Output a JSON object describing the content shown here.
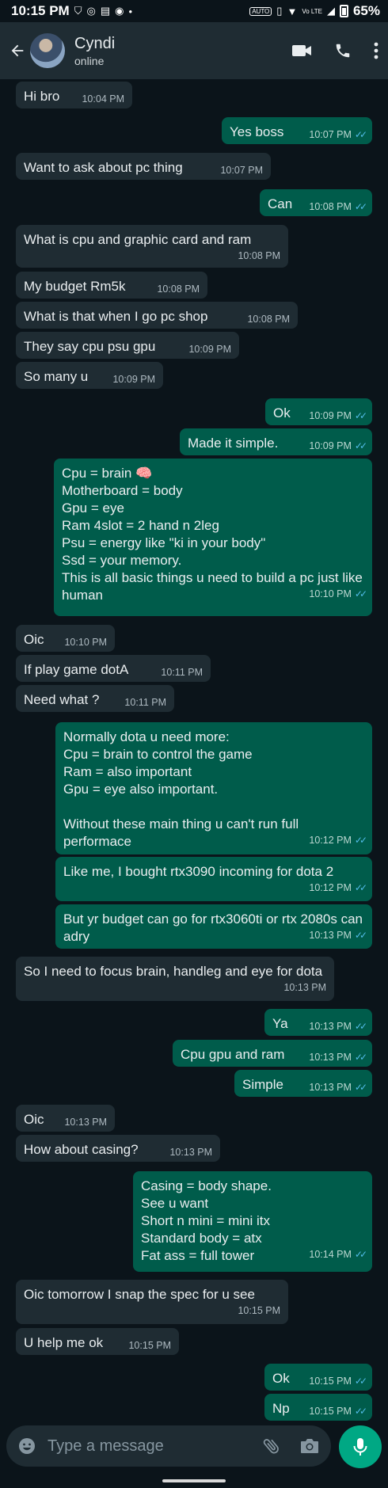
{
  "status_bar": {
    "time": "10:15 PM",
    "battery": "65%",
    "auto_label": "AUTO",
    "volte_label": "Vo LTE"
  },
  "header": {
    "contact_name": "Cyndi",
    "contact_status": "online"
  },
  "colors": {
    "incoming": "#1f2c33",
    "outgoing": "#005c4b",
    "accent": "#00a884",
    "read_ticks": "#53bdeb"
  },
  "messages": [
    {
      "dir": "in",
      "text": "Hi bro",
      "time": "10:04 PM"
    },
    {
      "dir": "out",
      "text": "Yes boss",
      "time": "10:07 PM"
    },
    {
      "dir": "in",
      "text": "Want to ask about pc thing",
      "time": "10:07 PM"
    },
    {
      "dir": "out",
      "text": "Can",
      "time": "10:08 PM"
    },
    {
      "dir": "in",
      "text": "What is cpu and graphic card and ram",
      "time": "10:08 PM"
    },
    {
      "dir": "in",
      "text": "My budget Rm5k",
      "time": "10:08 PM"
    },
    {
      "dir": "in",
      "text": "What is that when I go pc shop",
      "time": "10:08 PM"
    },
    {
      "dir": "in",
      "text": "They say cpu psu gpu",
      "time": "10:09 PM"
    },
    {
      "dir": "in",
      "text": "So many u",
      "time": "10:09 PM"
    },
    {
      "dir": "out",
      "text": "Ok",
      "time": "10:09 PM"
    },
    {
      "dir": "out",
      "text": "Made it simple.",
      "time": "10:09 PM"
    },
    {
      "dir": "out",
      "text": "Cpu = brain 🧠\nMotherboard = body\nGpu = eye\nRam 4slot = 2 hand n 2leg\nPsu = energy like \"ki in your body\"\nSsd = your memory.\nThis is all basic things u need to build a pc just like human",
      "time": "10:10 PM"
    },
    {
      "dir": "in",
      "text": "Oic",
      "time": "10:10 PM"
    },
    {
      "dir": "in",
      "text": "If play game dotA",
      "time": "10:11 PM"
    },
    {
      "dir": "in",
      "text": "Need what ?",
      "time": "10:11 PM"
    },
    {
      "dir": "out",
      "text": "Normally dota u need more:\nCpu = brain to control the game\nRam = also important\nGpu = eye also important.\n\nWithout these main thing u can't run full performace",
      "time": "10:12 PM"
    },
    {
      "dir": "out",
      "text": "Like me, I bought rtx3090 incoming for dota 2",
      "time": "10:12 PM"
    },
    {
      "dir": "out",
      "text": "But yr budget can go for rtx3060ti or rtx 2080s can adry",
      "time": "10:13 PM"
    },
    {
      "dir": "in",
      "text": "So I need to focus brain, handleg and eye for dota",
      "time": "10:13 PM"
    },
    {
      "dir": "out",
      "text": "Ya",
      "time": "10:13 PM"
    },
    {
      "dir": "out",
      "text": "Cpu gpu and ram",
      "time": "10:13 PM"
    },
    {
      "dir": "out",
      "text": "Simple",
      "time": "10:13 PM"
    },
    {
      "dir": "in",
      "text": "Oic",
      "time": "10:13 PM"
    },
    {
      "dir": "in",
      "text": "How about casing?",
      "time": "10:13 PM"
    },
    {
      "dir": "out",
      "text": "Casing = body shape.\nSee u want\nShort n mini = mini itx\nStandard body = atx\nFat ass = full tower",
      "time": "10:14 PM"
    },
    {
      "dir": "in",
      "text": "Oic tomorrow I snap the spec for u see",
      "time": "10:15 PM"
    },
    {
      "dir": "in",
      "text": "U help me ok",
      "time": "10:15 PM"
    },
    {
      "dir": "out",
      "text": "Ok",
      "time": "10:15 PM"
    },
    {
      "dir": "out",
      "text": "Np",
      "time": "10:15 PM"
    }
  ],
  "composer": {
    "placeholder": "Type a message"
  }
}
